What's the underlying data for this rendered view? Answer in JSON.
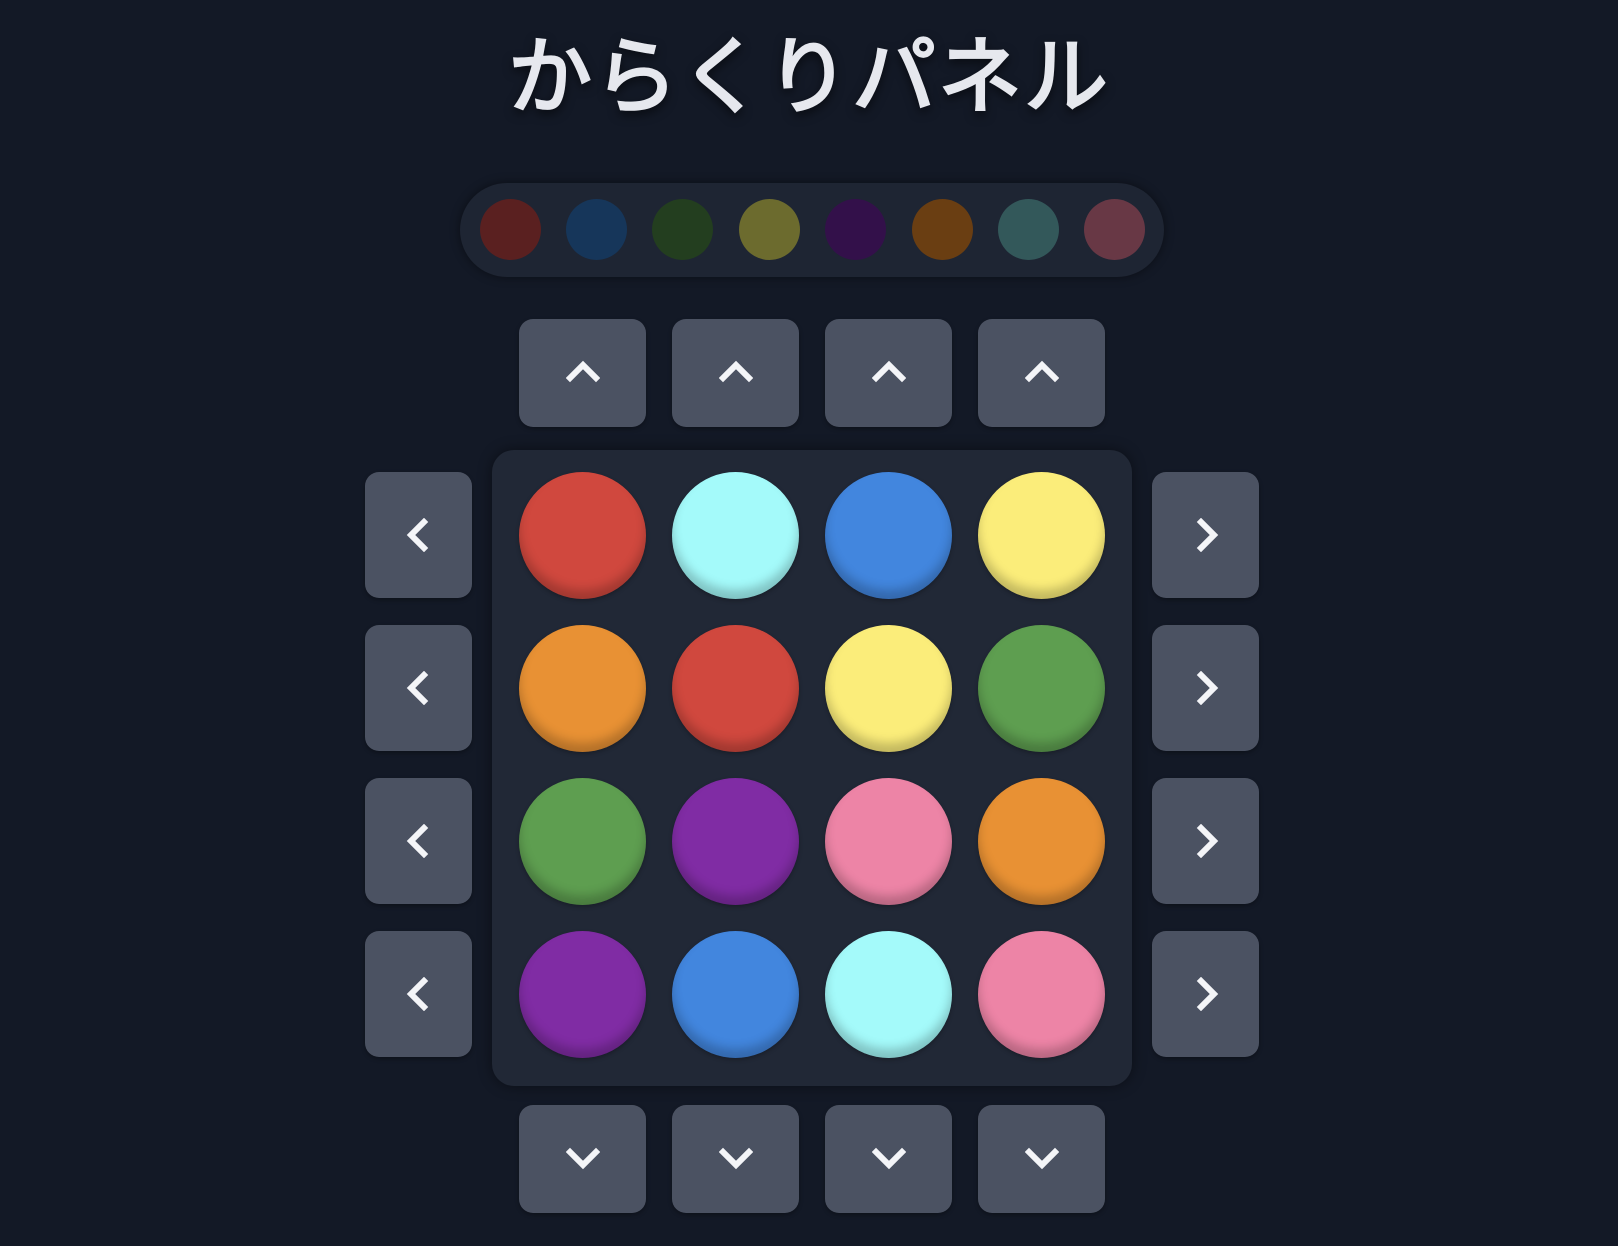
{
  "title": "からくりパネル",
  "target_colors": [
    {
      "name": "red",
      "color": "#5a2020"
    },
    {
      "name": "blue",
      "color": "#16365a"
    },
    {
      "name": "green",
      "color": "#233e1f"
    },
    {
      "name": "yellow",
      "color": "#6c6b2e"
    },
    {
      "name": "purple",
      "color": "#33104a"
    },
    {
      "name": "orange",
      "color": "#6a3e12"
    },
    {
      "name": "cyan",
      "color": "#33585a"
    },
    {
      "name": "pink",
      "color": "#683845"
    }
  ],
  "board": {
    "rows": 4,
    "cols": 4,
    "cells": [
      [
        "red",
        "cyan",
        "blue",
        "yellow"
      ],
      [
        "orange",
        "red",
        "yellow",
        "green"
      ],
      [
        "green",
        "purple",
        "pink",
        "orange"
      ],
      [
        "purple",
        "blue",
        "cyan",
        "pink"
      ]
    ]
  },
  "piece_colors": {
    "red": "#d0483e",
    "cyan": "#a4fafa",
    "blue": "#4286de",
    "yellow": "#fbed7a",
    "orange": "#e89134",
    "green": "#5e9e50",
    "purple": "#802ca4",
    "pink": "#ed84a6"
  },
  "controls": {
    "up_icon": "chevron-up-icon",
    "down_icon": "chevron-down-icon",
    "left_icon": "chevron-left-icon",
    "right_icon": "chevron-right-icon",
    "icon_color": "#f4f5f8"
  }
}
